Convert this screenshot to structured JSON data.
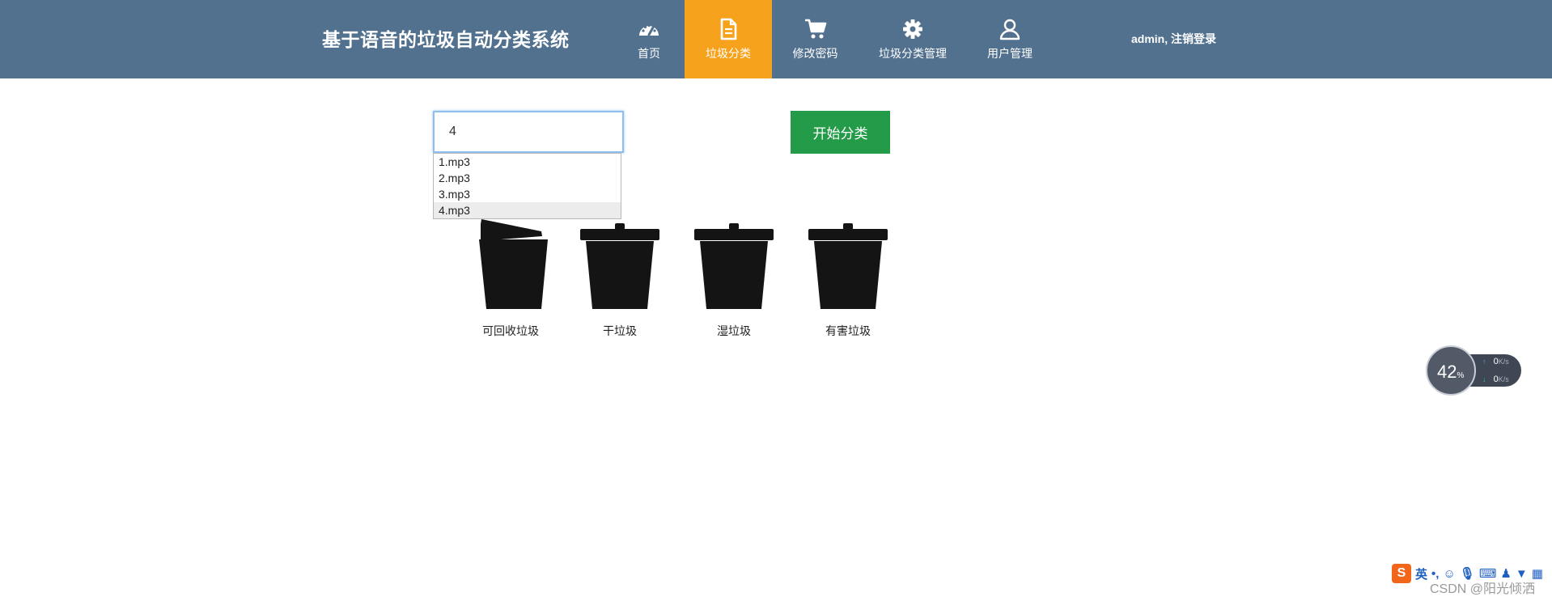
{
  "header": {
    "title": "基于语音的垃圾自动分类系统",
    "nav": [
      {
        "label": "首页",
        "icon": "dashboard-icon"
      },
      {
        "label": "垃圾分类",
        "icon": "document-icon",
        "active": true
      },
      {
        "label": "修改密码",
        "icon": "cart-icon"
      },
      {
        "label": "垃圾分类管理",
        "icon": "gear-icon"
      },
      {
        "label": "用户管理",
        "icon": "user-icon"
      }
    ],
    "user": "admin,",
    "logout": "注销登录"
  },
  "search": {
    "value": "4",
    "suggestions": [
      "1.mp3",
      "2.mp3",
      "3.mp3",
      "4.mp3"
    ],
    "highlighted_index": 3
  },
  "start_button": "开始分类",
  "bins": [
    {
      "label": "可回收垃圾",
      "lid_open": true
    },
    {
      "label": "干垃圾",
      "lid_open": false
    },
    {
      "label": "湿垃圾",
      "lid_open": false
    },
    {
      "label": "有害垃圾",
      "lid_open": false
    }
  ],
  "net_widget": {
    "percent": "42",
    "percent_sign": "%",
    "upload": "0",
    "download": "0",
    "unit": "K/s"
  },
  "ime": {
    "logo": "S",
    "mode": "英"
  },
  "watermark": "CSDN @阳光倾洒",
  "colors": {
    "header_bg": "#52718f",
    "active_nav": "#f7a21c",
    "start_button": "#249b48"
  }
}
